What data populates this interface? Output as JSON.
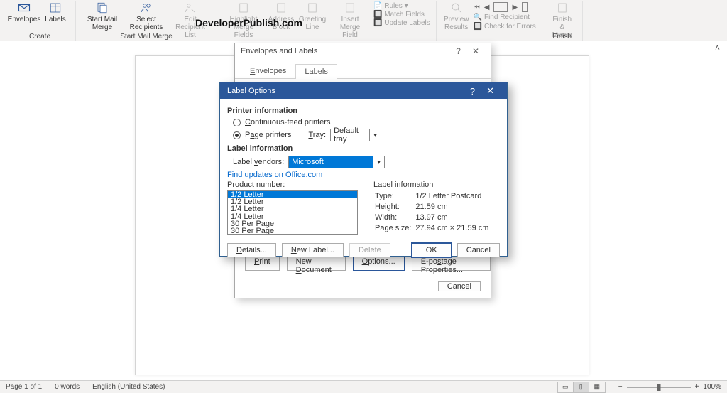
{
  "ribbon": {
    "create": {
      "label": "Create",
      "envelopes": "Envelopes",
      "labels": "Labels"
    },
    "start_merge": {
      "label": "Start Mail Merge",
      "start": "Start Mail\nMerge",
      "select": "Select\nRecipients",
      "edit": "Edit\nRecipient List"
    },
    "write": {
      "highlight": "Highlight\nMerge Fields",
      "address": "Address\nBlock",
      "greeting": "Greeting\nLine",
      "insert": "Insert Merge\nField",
      "rules": "Rules",
      "match": "Match Fields",
      "update": "Update Labels"
    },
    "preview": {
      "preview": "Preview\nResults",
      "find": "Find Recipient",
      "check": "Check for Errors"
    },
    "finish": {
      "label": "Finish",
      "finish": "Finish &\nMerge"
    }
  },
  "brand": "DeveloperPublish.com",
  "dlg1": {
    "title": "Envelopes and Labels",
    "tab_envelopes": "Envelopes",
    "tab_labels": "Labels",
    "print": "Print",
    "new_doc": "New Document",
    "options": "Options...",
    "epostage": "E-postage Properties...",
    "cancel": "Cancel"
  },
  "dlg2": {
    "title": "Label Options",
    "printer_info": "Printer information",
    "cont_feed": "Continuous-feed printers",
    "page_printers": "Page printers",
    "tray_lbl": "Tray:",
    "tray_val": "Default tray",
    "label_info_head": "Label information",
    "vendors_lbl": "Label vendors:",
    "vendor": "Microsoft",
    "updates": "Find updates on Office.com",
    "product_lbl": "Product number:",
    "products": [
      "1/2 Letter",
      "1/2 Letter",
      "1/4 Letter",
      "1/4 Letter",
      "30 Per Page",
      "30 Per Page"
    ],
    "lab_info": {
      "head": "Label information",
      "type_k": "Type:",
      "type_v": "1/2 Letter Postcard",
      "height_k": "Height:",
      "height_v": "21.59 cm",
      "width_k": "Width:",
      "width_v": "13.97 cm",
      "page_k": "Page size:",
      "page_v": "27.94 cm × 21.59 cm"
    },
    "details": "Details...",
    "new_label": "New Label...",
    "delete": "Delete",
    "ok": "OK",
    "cancel": "Cancel"
  },
  "status": {
    "page": "Page 1 of 1",
    "words": "0 words",
    "lang": "English (United States)",
    "zoom": "100%"
  }
}
